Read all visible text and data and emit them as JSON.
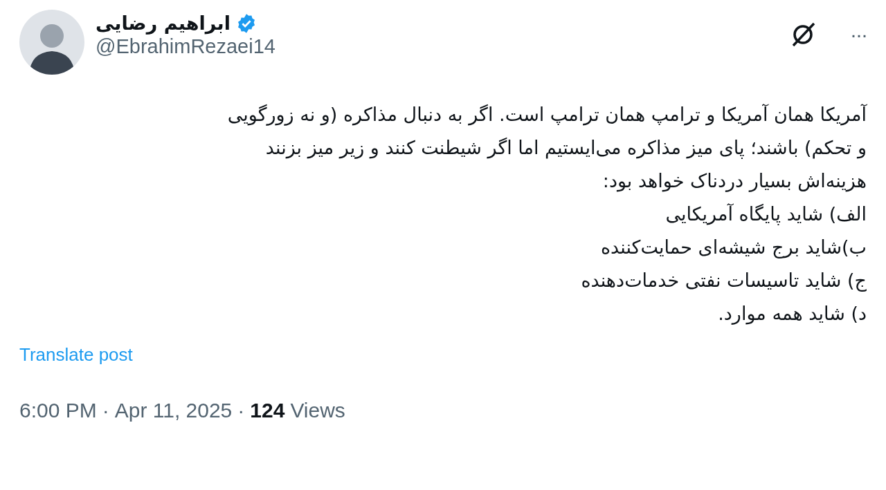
{
  "author": {
    "name": "ابراهیم رضایی",
    "verified": true,
    "handle": "@EbrahimRezaei14"
  },
  "body_lines": [
    "آمریکا همان آمریکا و ترامپ همان ترامپ است. اگر به دنبال مذاکره (و نه زورگویی",
    "و تحکم) باشند؛ پای میز مذاکره می‌ایستیم اما اگر شیطنت کنند و زیر میز بزنند",
    "هزینه‌اش بسیار دردناک خواهد بود:",
    "الف) شاید پایگاه آمریکایی",
    "ب)شاید برج شیشه‌ای حمایت‌کننده",
    "ج) شاید تاسیسات نفتی خدمات‌دهنده",
    "د) شاید همه موارد."
  ],
  "translate_link": "Translate post",
  "meta": {
    "time": "6:00 PM",
    "separator_1": "·",
    "date": "Apr 11, 2025",
    "separator_2": "·",
    "views_count": "124",
    "views_label": "Views"
  },
  "more_button": "···"
}
